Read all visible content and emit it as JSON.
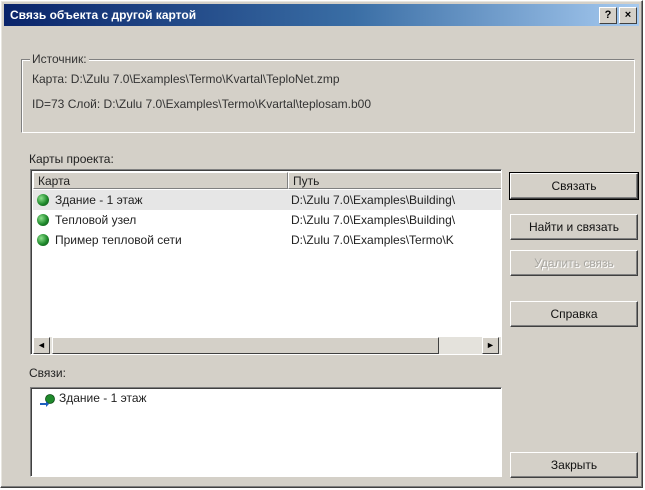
{
  "window": {
    "title": "Связь объекта с другой картой",
    "help_label": "?",
    "close_label": "×"
  },
  "source": {
    "legend": "Источник:",
    "map_line": "Карта: D:\\Zulu 7.0\\Examples\\Termo\\Kvartal\\TeploNet.zmp",
    "id_line": "ID=73  Слой: D:\\Zulu 7.0\\Examples\\Termo\\Kvartal\\teplosam.b00"
  },
  "project_maps": {
    "label": "Карты проекта:",
    "columns": [
      "Карта",
      "Путь"
    ],
    "rows": [
      {
        "map": "Здание - 1 этаж",
        "path": "D:\\Zulu 7.0\\Examples\\Building\\",
        "icon": "map-icon",
        "selected": true
      },
      {
        "map": "Тепловой узел",
        "path": "D:\\Zulu 7.0\\Examples\\Building\\",
        "icon": "map-icon",
        "selected": false
      },
      {
        "map": "Пример тепловой сети",
        "path": "D:\\Zulu 7.0\\Examples\\Termo\\K",
        "icon": "map-icon",
        "selected": false
      }
    ],
    "scroll_left": "◄",
    "scroll_right": "►"
  },
  "links": {
    "label": "Связи:",
    "items": [
      {
        "label": "Здание - 1 этаж",
        "icon": "link-map-icon"
      }
    ]
  },
  "buttons": {
    "link": "Связать",
    "find_link": "Найти и связать",
    "delete_link": "Удалить связь",
    "help": "Справка",
    "close": "Закрыть"
  },
  "colors": {
    "titlebar_start": "#0a246a",
    "titlebar_end": "#a6caf0",
    "face": "#d4d0c8"
  }
}
